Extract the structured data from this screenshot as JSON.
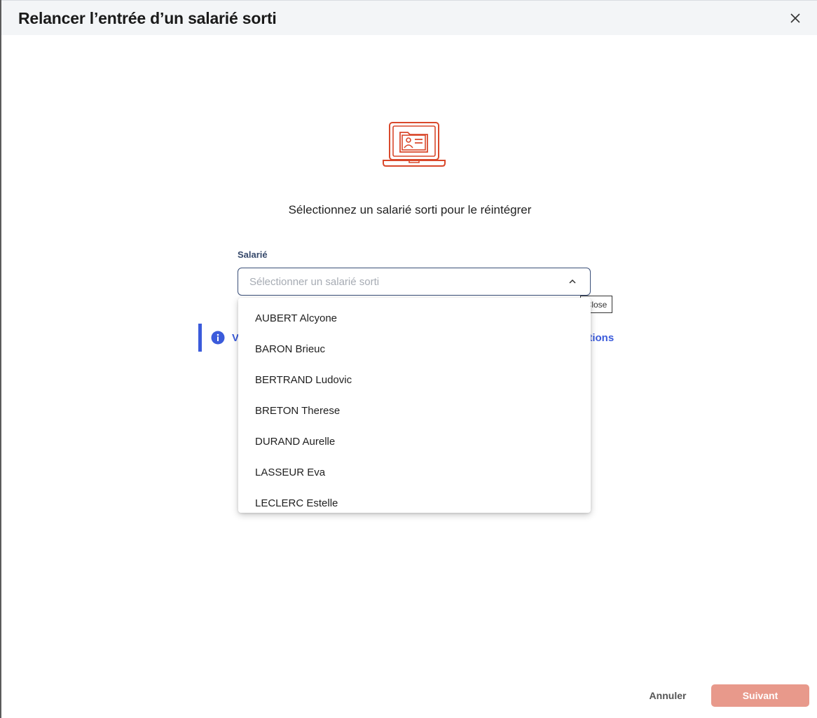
{
  "modal": {
    "title": "Relancer l’entrée d’un salarié sorti",
    "close_icon": "close-icon"
  },
  "main": {
    "illustration_icon": "laptop-employee-folder-icon",
    "subtitle": "Sélectionnez un salarié sorti pour le réintégrer",
    "field_label": "Salarié",
    "select_placeholder": "Sélectionner un salarié sorti",
    "tooltip": "Close",
    "info_banner": {
      "icon": "info-icon",
      "text_left_visible": "V",
      "text_right_visible": "ations"
    },
    "dropdown_options": [
      "AUBERT Alcyone",
      "BARON Brieuc",
      "BERTRAND Ludovic",
      "BRETON Therese",
      "DURAND Aurelle",
      "LASSEUR Eva",
      "LECLERC Estelle"
    ]
  },
  "footer": {
    "cancel_label": "Annuler",
    "next_label": "Suivant"
  },
  "colors": {
    "accent_orange": "#d9482b",
    "next_button": "#e8998b",
    "info_blue": "#3b5bdb",
    "label_navy": "#36496b"
  }
}
